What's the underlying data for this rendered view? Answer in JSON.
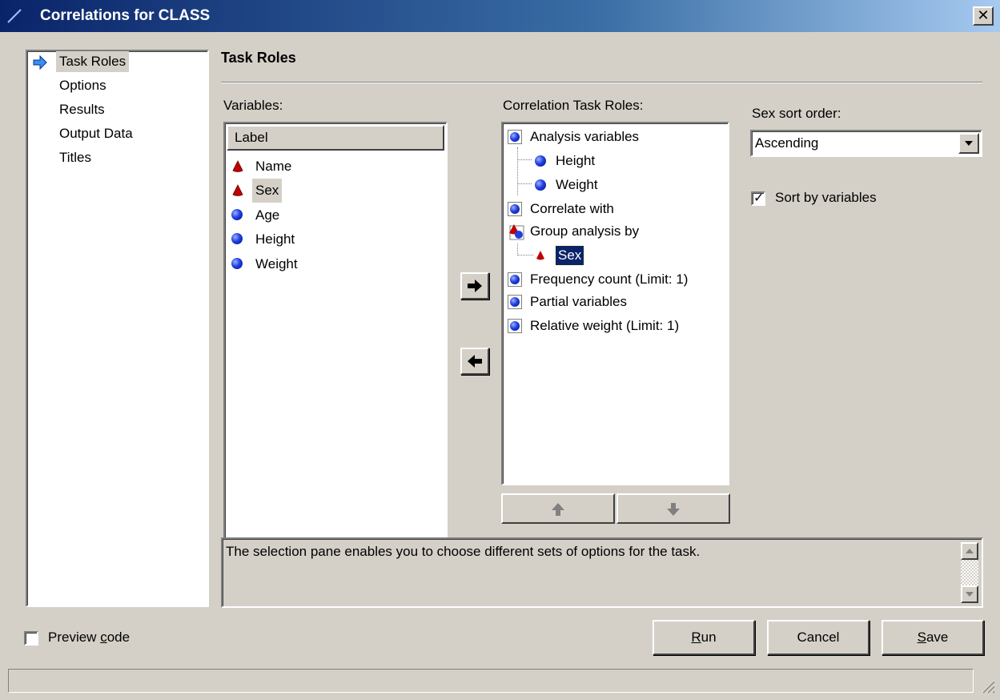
{
  "window": {
    "title": "Correlations for CLASS",
    "close_label": "✕"
  },
  "nav": {
    "items": [
      {
        "label": "Task Roles",
        "selected": true
      },
      {
        "label": "Options"
      },
      {
        "label": "Results"
      },
      {
        "label": "Output Data"
      },
      {
        "label": "Titles"
      }
    ]
  },
  "section_title": "Task Roles",
  "variables": {
    "label": "Variables:",
    "column_header": "Label",
    "items": [
      {
        "name": "Name",
        "type": "character"
      },
      {
        "name": "Sex",
        "type": "character",
        "selected": true
      },
      {
        "name": "Age",
        "type": "numeric"
      },
      {
        "name": "Height",
        "type": "numeric"
      },
      {
        "name": "Weight",
        "type": "numeric"
      }
    ]
  },
  "roles": {
    "label": "Correlation Task Roles:",
    "analysis_variables": "Analysis variables",
    "analysis_children": [
      "Height",
      "Weight"
    ],
    "correlate_with": "Correlate with",
    "group_analysis_by": "Group analysis by",
    "group_children": [
      "Sex"
    ],
    "frequency_count": "Frequency count  (Limit: 1)",
    "partial_variables": "Partial variables",
    "relative_weight": "Relative weight  (Limit: 1)"
  },
  "sort": {
    "label": "Sex sort order:",
    "value": "Ascending",
    "sort_by_variables_label": "Sort by variables",
    "sort_by_variables_checked": true
  },
  "description": "The selection pane enables you to choose different sets of options for the task.",
  "preview": {
    "label_prefix": "Preview ",
    "label_accel": "c",
    "label_rest": "ode",
    "checked": false
  },
  "buttons": {
    "run_accel": "R",
    "run_rest": "un",
    "cancel": "Cancel",
    "save_accel": "S",
    "save_rest": "ave"
  },
  "icons": {
    "numeric": "blue-ball-icon",
    "character": "red-cone-icon",
    "nav_arrow": "blue-arrow-icon"
  },
  "colors": {
    "title_bar_start": "#0a246a",
    "title_bar_end": "#a6caf0",
    "face": "#d4d0c8",
    "selection": "#0a246a"
  }
}
